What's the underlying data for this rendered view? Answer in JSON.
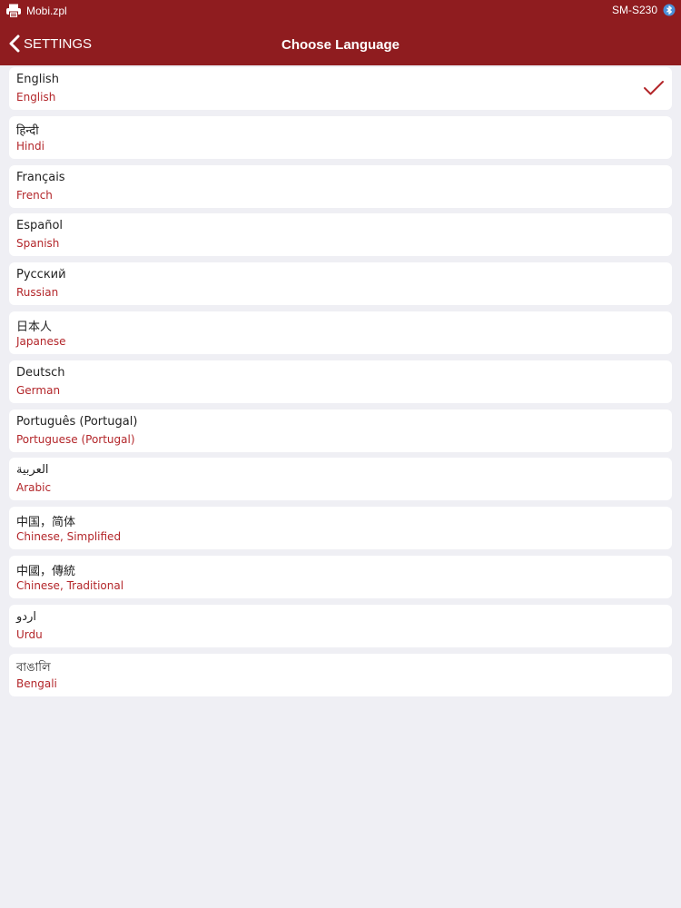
{
  "status_bar": {
    "app_name": "Mobi.zpl",
    "device": "SM-S230",
    "left_icon": "printer-icon",
    "right_icon": "bluetooth-icon"
  },
  "nav": {
    "back_label": "SETTINGS",
    "title": "Choose Language"
  },
  "colors": {
    "accent": "#8f1c1f",
    "secondary_text": "#b3262a",
    "background": "#efeff4"
  },
  "languages": [
    {
      "native": "English",
      "english": "English",
      "selected": true
    },
    {
      "native": "हिन्दी",
      "english": "Hindi",
      "selected": false
    },
    {
      "native": "Français",
      "english": "French",
      "selected": false
    },
    {
      "native": "Español",
      "english": "Spanish",
      "selected": false
    },
    {
      "native": "Русский",
      "english": "Russian",
      "selected": false
    },
    {
      "native": "日本人",
      "english": "Japanese",
      "selected": false
    },
    {
      "native": "Deutsch",
      "english": "German",
      "selected": false
    },
    {
      "native": "Português (Portugal)",
      "english": "Portuguese (Portugal)",
      "selected": false
    },
    {
      "native": "العربية",
      "english": "Arabic",
      "selected": false
    },
    {
      "native": "中国，简体",
      "english": "Chinese, Simplified",
      "selected": false
    },
    {
      "native": "中國，傳統",
      "english": "Chinese, Traditional",
      "selected": false
    },
    {
      "native": "اردو",
      "english": "Urdu",
      "selected": false
    },
    {
      "native": "বাঙালি",
      "english": "Bengali",
      "selected": false
    }
  ]
}
